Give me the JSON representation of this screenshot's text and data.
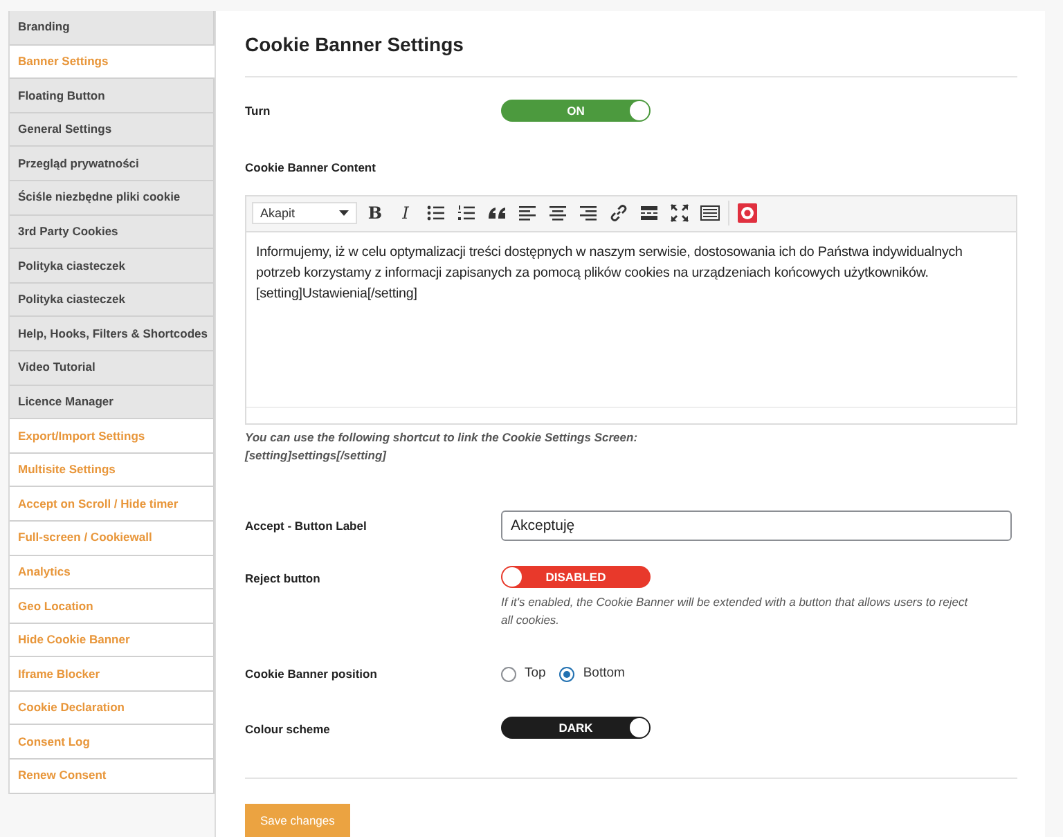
{
  "sidebar": {
    "items": [
      {
        "label": "Branding",
        "kind": "core",
        "selected": false
      },
      {
        "label": "Banner Settings",
        "kind": "core",
        "selected": true
      },
      {
        "label": "Floating Button",
        "kind": "core",
        "selected": false
      },
      {
        "label": "General Settings",
        "kind": "core",
        "selected": false
      },
      {
        "label": "Przegląd prywatności",
        "kind": "core",
        "selected": false
      },
      {
        "label": "Ściśle niezbędne pliki cookie",
        "kind": "core",
        "selected": false
      },
      {
        "label": "3rd Party Cookies",
        "kind": "core",
        "selected": false
      },
      {
        "label": "Polityka ciasteczek",
        "kind": "core",
        "selected": false
      },
      {
        "label": "Polityka ciasteczek",
        "kind": "core",
        "selected": false
      },
      {
        "label": "Help, Hooks, Filters & Shortcodes",
        "kind": "core",
        "selected": false
      },
      {
        "label": "Video Tutorial",
        "kind": "core",
        "selected": false
      },
      {
        "label": "Licence Manager",
        "kind": "core",
        "selected": false
      },
      {
        "label": "Export/Import Settings",
        "kind": "addon",
        "selected": false
      },
      {
        "label": "Multisite Settings",
        "kind": "addon",
        "selected": false
      },
      {
        "label": "Accept on Scroll / Hide timer",
        "kind": "addon",
        "selected": false
      },
      {
        "label": "Full-screen / Cookiewall",
        "kind": "addon",
        "selected": false
      },
      {
        "label": "Analytics",
        "kind": "addon",
        "selected": false
      },
      {
        "label": "Geo Location",
        "kind": "addon",
        "selected": false
      },
      {
        "label": "Hide Cookie Banner",
        "kind": "addon",
        "selected": false
      },
      {
        "label": "Iframe Blocker",
        "kind": "addon",
        "selected": false
      },
      {
        "label": "Cookie Declaration",
        "kind": "addon",
        "selected": false
      },
      {
        "label": "Consent Log",
        "kind": "addon",
        "selected": false
      },
      {
        "label": "Renew Consent",
        "kind": "addon",
        "selected": false
      }
    ]
  },
  "title": "Cookie Banner Settings",
  "turn": {
    "label": "Turn",
    "toggle": {
      "text": "ON",
      "on": true,
      "color": "#4c9a3e"
    }
  },
  "content": {
    "label": "Cookie Banner Content",
    "editor": {
      "format": "Akapit",
      "toolbar": [
        {
          "kind": "bold",
          "glyph": "B"
        },
        {
          "kind": "italic",
          "glyph": "I"
        },
        {
          "kind": "bullets"
        },
        {
          "kind": "numbers"
        },
        {
          "kind": "quote"
        },
        {
          "kind": "align-left"
        },
        {
          "kind": "align-center"
        },
        {
          "kind": "align-right"
        },
        {
          "kind": "link"
        },
        {
          "kind": "more"
        },
        {
          "kind": "fullscreen"
        },
        {
          "kind": "keyboard"
        },
        {
          "kind": "plugin"
        }
      ],
      "paragraphs": [
        "Informujemy, iż w celu optymalizacji treści dostępnych w naszym serwisie, dostosowania ich do Państwa indywidualnych potrzeb korzystamy z informacji zapisanych za pomocą plików cookies na urządzeniach końcowych użytkowników.",
        "[setting]Ustawienia[/setting]"
      ]
    },
    "hint": [
      "You can use the following shortcut to link the Cookie Settings Screen:",
      "[setting]settings[/setting]"
    ]
  },
  "fields": [
    {
      "kind": "input",
      "label": "Accept - Button Label",
      "value": "Akceptuję"
    },
    {
      "kind": "toggle",
      "label": "Reject button",
      "toggle": {
        "text": "DISABLED",
        "on": false,
        "color": "#e8392b"
      },
      "hint": "If it's enabled, the Cookie Banner will be extended with a button that allows users to reject all cookies."
    },
    {
      "kind": "radio",
      "label": "Cookie Banner position",
      "options": [
        {
          "label": "Top",
          "selected": false
        },
        {
          "label": "Bottom",
          "selected": true
        }
      ]
    },
    {
      "kind": "toggle",
      "label": "Colour scheme",
      "toggle": {
        "text": "DARK",
        "on": true,
        "color": "#1d1d1d"
      }
    }
  ],
  "save_button": "Save changes"
}
